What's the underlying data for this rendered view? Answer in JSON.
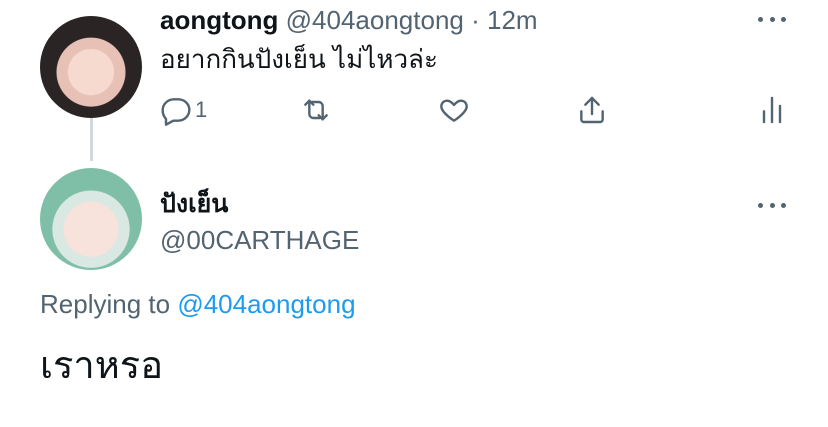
{
  "original_tweet": {
    "author_name": "aongtong",
    "handle": "@404aongtong",
    "separator": "·",
    "time": "12m",
    "text": "อยากกินปังเย็น ไม่ไหวล่ะ",
    "reply_count": "1",
    "icons": [
      "reply-icon",
      "retweet-icon",
      "like-icon",
      "share-icon",
      "analytics-icon",
      "more-icon"
    ]
  },
  "reply_tweet": {
    "author_name": "ปังเย็น",
    "handle": "@00CARTHAGE",
    "replying_label": "Replying to",
    "replying_to": "@404aongtong",
    "text": "เราหรอ",
    "icons": [
      "more-icon"
    ]
  },
  "colors": {
    "text_primary": "#0f1419",
    "text_secondary": "#536471",
    "mention": "#1d9bf0",
    "thread_line": "#cfd9de",
    "background": "#ffffff"
  }
}
